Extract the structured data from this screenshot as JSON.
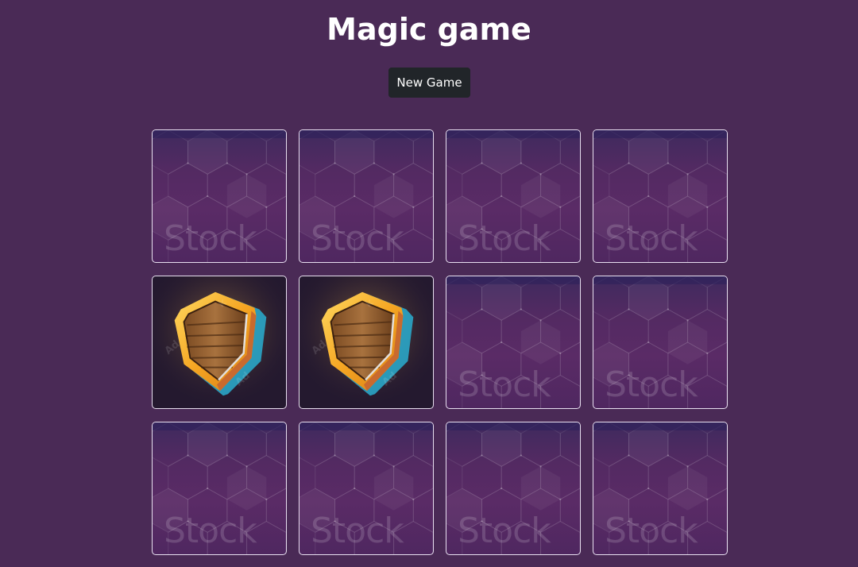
{
  "header": {
    "title": "Magic game"
  },
  "controls": {
    "new_game_label": "New Game"
  },
  "board": {
    "rows": 3,
    "columns": 4,
    "cards": [
      {
        "state": "face-down",
        "back_watermark": "Stock"
      },
      {
        "state": "face-down",
        "back_watermark": "Stock"
      },
      {
        "state": "face-down",
        "back_watermark": "Stock"
      },
      {
        "state": "face-down",
        "back_watermark": "Stock"
      },
      {
        "state": "face-up",
        "icon": "wooden-shield-icon"
      },
      {
        "state": "face-up",
        "icon": "wooden-shield-icon"
      },
      {
        "state": "face-down",
        "back_watermark": "Stock"
      },
      {
        "state": "face-down",
        "back_watermark": "Stock"
      },
      {
        "state": "face-down",
        "back_watermark": "Stock"
      },
      {
        "state": "face-down",
        "back_watermark": "Stock"
      },
      {
        "state": "face-down",
        "back_watermark": "Stock"
      },
      {
        "state": "face-down",
        "back_watermark": "Stock"
      }
    ]
  },
  "colors": {
    "background": "#4a2a56",
    "button": "#212529",
    "card_border": "#e8dff0"
  }
}
